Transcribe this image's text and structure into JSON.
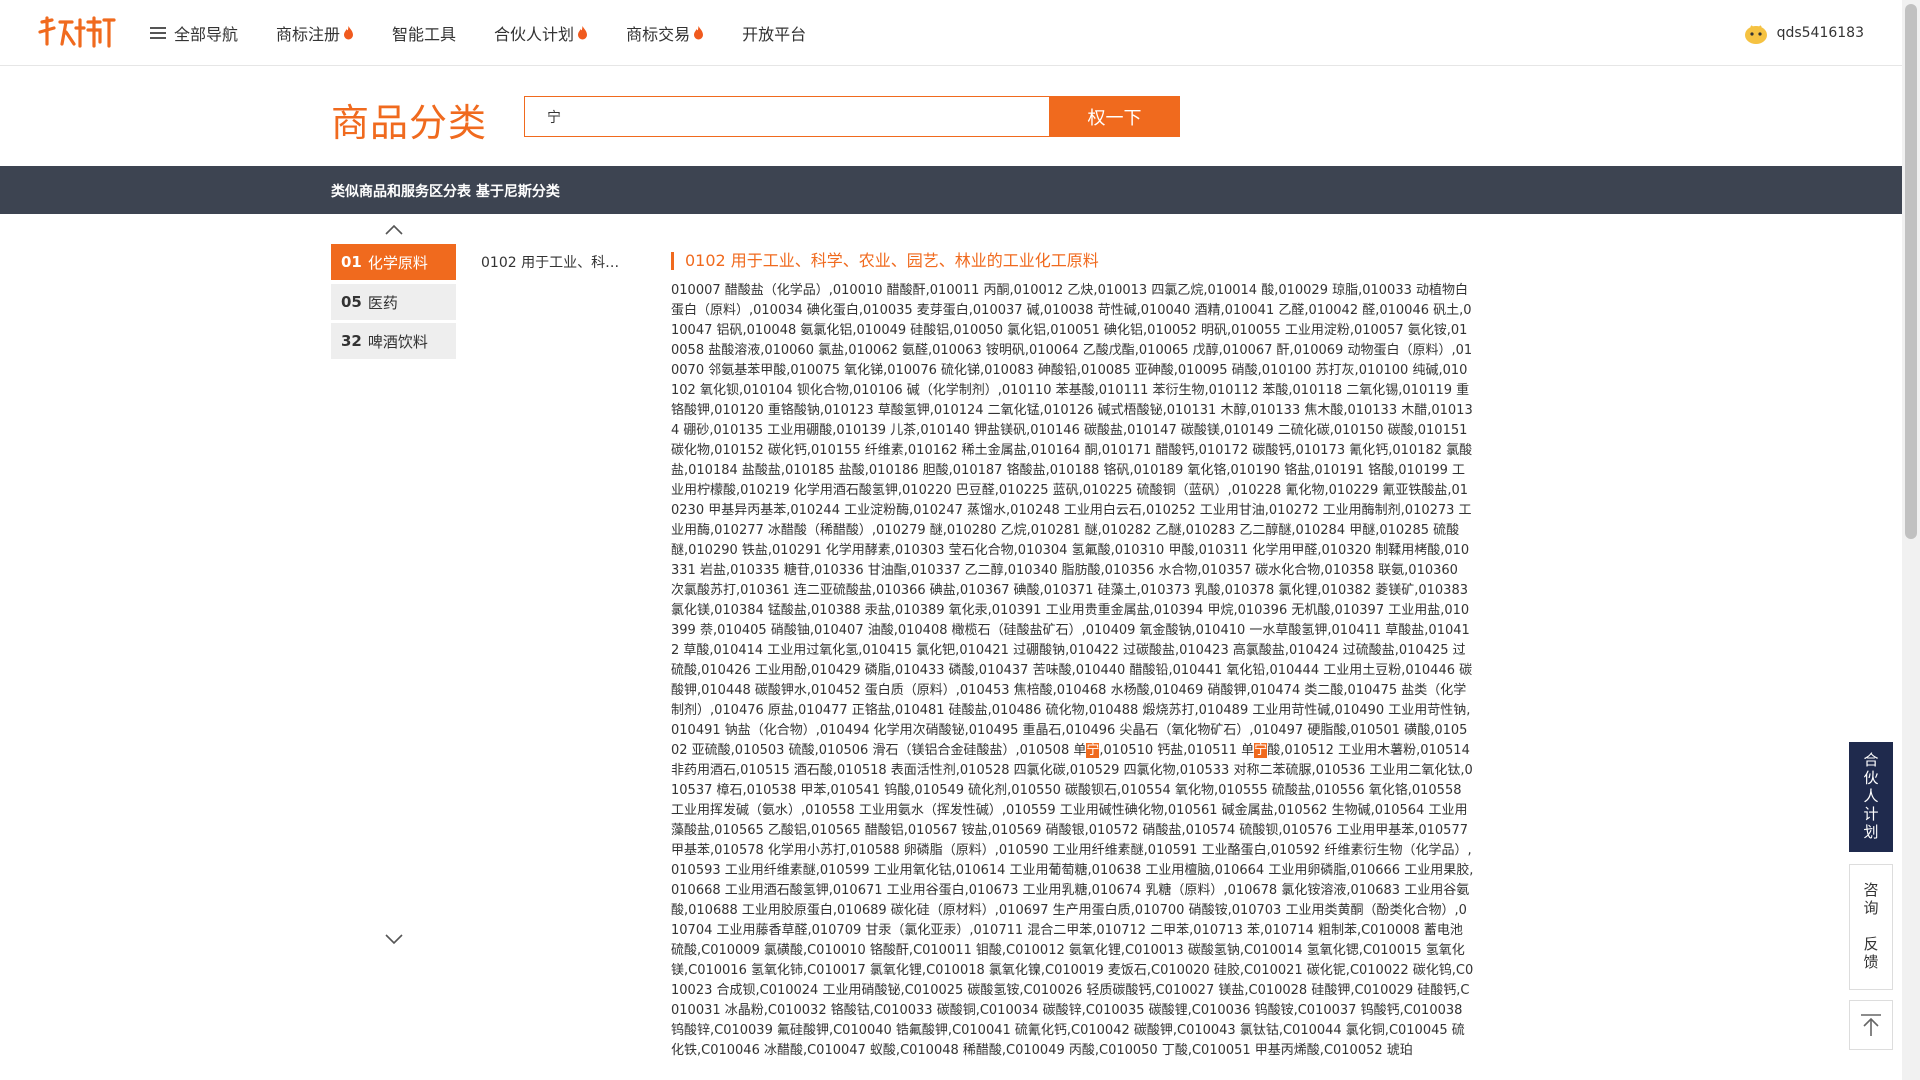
{
  "nav": {
    "all_nav_label": "全部导航",
    "items": [
      {
        "label": "商标注册",
        "hot": true
      },
      {
        "label": "智能工具",
        "hot": false
      },
      {
        "label": "合伙人计划",
        "hot": true
      },
      {
        "label": "商标交易",
        "hot": true
      },
      {
        "label": "开放平台",
        "hot": false
      }
    ],
    "username": "qds5416183"
  },
  "header": {
    "title": "商品分类",
    "search_value": "宁",
    "search_button": "权一下"
  },
  "banner": {
    "text": "类似商品和服务区分表 基于尼斯分类"
  },
  "categories": [
    {
      "num": "01",
      "label": "化学原料",
      "active": true
    },
    {
      "num": "05",
      "label": "医药",
      "active": false
    },
    {
      "num": "32",
      "label": "啤酒饮料",
      "active": false
    }
  ],
  "subcategory": "0102 用于工业、科…",
  "content": {
    "title": "0102 用于工业、科学、农业、园艺、林业的工业化工原料",
    "body_part1": "010007 醋酸盐（化学品）,010010 醋酸酐,010011 丙酮,010012 乙炔,010013 四氯乙烷,010014 酸,010029 琼脂,010033 动植物白蛋白（原料）,010034 碘化蛋白,010035 麦芽蛋白,010037 碱,010038 苛性碱,010040 酒精,010041 乙醛,010042 醛,010046 矾土,010047 铝矾,010048 氨氯化铝,010049 硅酸铝,010050 氯化铝,010051 碘化铝,010052 明矾,010055 工业用淀粉,010057 氨化铵,010058 盐酸溶液,010060 氯盐,010062 氨醛,010063 铵明矾,010064 乙酸戊酯,010065 戊醇,010067 酐,010069 动物蛋白（原料）,010070 邻氨基苯甲酸,010075 氧化锑,010076 硫化锑,010083 砷酸铅,010085 亚砷酸,010095 硝酸,010100 苏打灰,010100 纯碱,010102 氧化钡,010104 钡化合物,010106 碱（化学制剂）,010110 苯基酸,010111 苯衍生物,010112 苯酸,010118 二氧化锡,010119 重铬酸钾,010120 重铬酸钠,010123 草酸氢钾,010124 二氧化锰,010126 碱式梧酸铋,010131 木醇,010133 焦木酸,010133 木醋,010134 硼砂,010135 工业用硼酸,010139 儿茶,010140 钾盐镁矾,010146 碳酸盐,010147 碳酸镁,010149 二硫化碳,010150 碳酸,010151 碳化物,010152 碳化钙,010155 纤维素,010162 稀土金属盐,010164 酮,010171 醋酸钙,010172 碳酸钙,010173 氰化钙,010182 氯酸盐,010184 盐酸盐,010185 盐酸,010186 胆酸,010187 铬酸盐,010188 铬矾,010189 氧化铬,010190 铬盐,010191 铬酸,010199 工业用柠檬酸,010219 化学用酒石酸氢钾,010220 巴豆醛,010225 蓝矾,010225 硫酸铜（蓝矾）,010228 氰化物,010229 氰亚铁酸盐,010230 甲基异丙基苯,010244 工业淀粉酶,010247 蒸馏水,010248 工业用白云石,010252 工业用甘油,010272 工业用酶制剂,010273 工业用酶,010277 冰醋酸（稀醋酸）,010279 醚,010280 乙烷,010281 醚,010282 乙醚,010283 乙二醇醚,010284 甲醚,010285 硫酸醚,010290 铁盐,010291 化学用酵素,010303 莹石化合物,010304 氢氟酸,010310 甲酸,010311 化学用甲醛,010320 制鞣用栲酸,010331 岩盐,010335 糖苷,010336 甘油酯,010337 乙二醇,010340 脂肪酸,010356 水合物,010357 碳水化合物,010358 联氨,010360 次氯酸苏打,010361 连二亚硫酸盐,010366 碘盐,010367 碘酸,010371 硅藻土,010373 乳酸,010378 氯化锂,010382 菱镁矿,010383 氯化镁,010384 锰酸盐,010388 汞盐,010389 氧化汞,010391 工业用贵重金属盐,010394 甲烷,010396 无机酸,010397 工业用盐,010399 萘,010405 硝酸铀,010407 油酸,010408 橄榄石（硅酸盐矿石）,010409 氧金酸钠,010410 一水草酸氢钾,010411 草酸盐,010412 草酸,010414 工业用过氧化氢,010415 氯化钯,010421 过硼酸钠,010422 过碳酸盐,010423 高氯酸盐,010424 过硫酸盐,010425 过硫酸,010426 工业用酚,010429 磷脂,010433 磷酸,010437 苦味酸,010440 醋酸铅,010441 氧化铅,010444 工业用土豆粉,010446 碳酸钾,010448 碳酸钾水,010452 蛋白质（原料）,010453 焦棓酸,010468 水杨酸,010469 硝酸钾,010474 类二酸,010475 盐类（化学制剂）,010476 原盐,010477 正铬盐,010481 硅酸盐,010486 硫化物,010488 煅烧苏打,010489 工业用苛性碱,010490 工业用苛性钠,010491 钠盐（化合物）,010494 化学用次硝酸铋,010495 重晶石,010496 尖晶石（氧化物矿石）,010497 硬脂酸,010501 磺酸,010502 亚硫酸,010503 硫酸,010506 滑石（镁铝合金硅酸盐）,010508 单",
    "highlight": "宁",
    "body_part2": ",010510 钙盐,010511 单",
    "body_part3": "酸,010512 工业用木薯粉,010514 非药用酒石,010515 酒石酸,010518 表面活性剂,010528 四氯化碳,010529 四氯化物,010533 对称二苯硫脲,010536 工业用二氧化钛,010537 樟石,010538 甲苯,010541 钨酸,010549 硫化剂,010550 碳酸钡石,010554 氧化物,010555 硫酸盐,010556 氧化铬,010558 工业用挥发碱（氨水）,010558 工业用氨水（挥发性碱）,010559 工业用碱性碘化物,010561 碱金属盐,010562 生物碱,010564 工业用藻酸盐,010565 乙酸铝,010565 醋酸铝,010567 铵盐,010569 硝酸银,010572 硝酸盐,010574 硫酸钡,010576 工业用甲基苯,010577 甲基苯,010578 化学用小苏打,010588 卵磷脂（原料）,010590 工业用纤维素醚,010591 工业酪蛋白,010592 纤维素衍生物（化学品）,010593 工业用纤维素醚,010599 工业用氧化钴,010614 工业用葡萄糖,010638 工业用檀脑,010664 工业用卵磷脂,010666 工业用果胶,010668 工业用酒石酸氢钾,010671 工业用谷蛋白,010673 工业用乳糖,010674 乳糖（原料）,010678 氯化铵溶液,010683 工业用谷氨酸,010688 工业用胶原蛋白,010689 碳化硅（原材料）,010697 生产用蛋白质,010700 硝酸铵,010703 工业用类黄酮（酚类化合物）,010704 工业用藤香草醛,010709 甘汞（氯化亚汞）,010711 混合二甲苯,010712 二甲苯,010713 苯,010714 粗制苯,C010008 蓄电池硫酸,C010009 氯磺酸,C010010 铬酸酐,C010011 钼酸,C010012 氨氧化锂,C010013 碳酸氢钠,C010014 氢氧化锶,C010015 氢氧化镁,C010016 氢氧化铈,C010017 氯氧化锂,C010018 氯氧化镍,C010019 麦饭石,C010020 硅胶,C010021 碳化铌,C010022 碳化钨,C010023 合成钡,C010024 工业用硝酸铋,C010025 碳酸氢铵,C010026 轻质碳酸钙,C010027 镁盐,C010028 硅酸钾,C010029 硅酸钙,C010031 冰晶粉,C010032 铬酸钴,C010033 碳酸铜,C010034 碳酸锌,C010035 碳酸锂,C010036 钨酸铵,C010037 钨酸钙,C010038 钨酸锌,C010039 氟硅酸钾,C010040 锆氟酸钾,C010041 硫氰化钙,C010042 碳酸钾,C010043 氯钛钴,C010044 氯化铜,C010045 硫化铁,C010046 冰醋酸,C010047 蚁酸,C010048 稀醋酸,C010049 丙酸,C010050 丁酸,C010051 甲基丙烯酸,C010052 琥珀"
  },
  "float": {
    "partner": "合伙人计划",
    "consult": "咨询",
    "feedback": "反馈"
  },
  "colors": {
    "accent": "#f06a1e",
    "banner": "#3d4451",
    "float_dark": "#1f2a4d"
  }
}
